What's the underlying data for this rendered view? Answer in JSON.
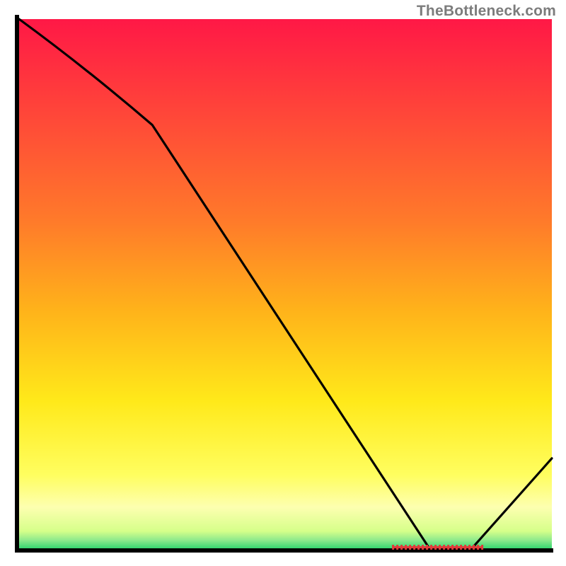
{
  "attribution": "TheBottleneck.com",
  "chart_data": {
    "type": "line",
    "title": "",
    "xlabel": "",
    "ylabel": "",
    "xlim": [
      0,
      100
    ],
    "ylim": [
      0,
      100
    ],
    "x": [
      0,
      25,
      77,
      85,
      100
    ],
    "values": [
      100,
      80,
      0,
      0,
      17
    ],
    "optimal_band": {
      "x_start": 70,
      "x_end": 87
    },
    "colors": {
      "top": "#ff1846",
      "mid1": "#ff9a1e",
      "mid2": "#ffe91a",
      "mid3": "#fdff94",
      "bottom": "#27d36c"
    }
  }
}
